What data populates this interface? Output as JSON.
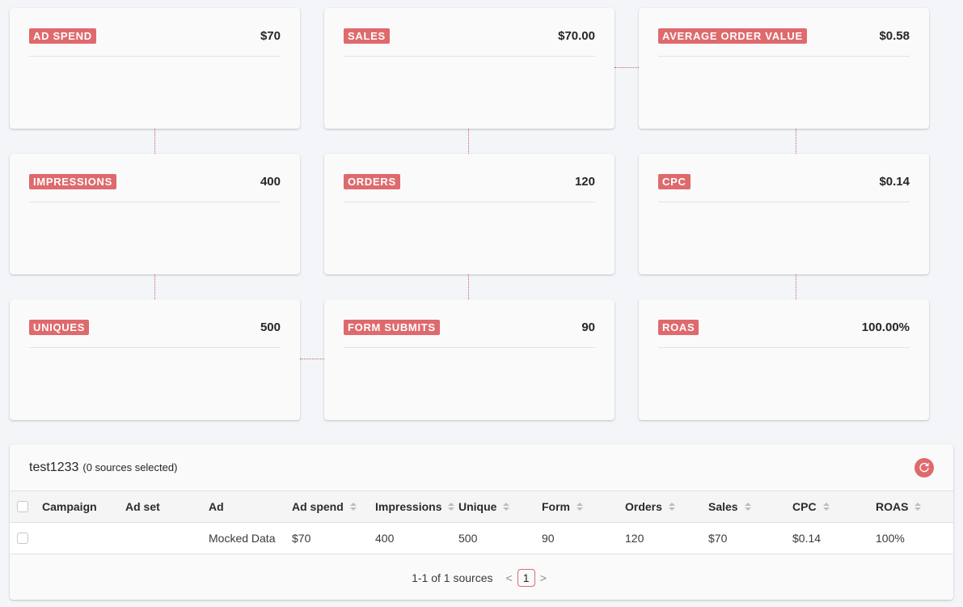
{
  "metrics": {
    "ad_spend": {
      "label": "AD SPEND",
      "value": "$70"
    },
    "sales": {
      "label": "SALES",
      "value": "$70.00"
    },
    "aov": {
      "label": "AVERAGE ORDER VALUE",
      "value": "$0.58"
    },
    "impressions": {
      "label": "IMPRESSIONS",
      "value": "400"
    },
    "orders": {
      "label": "ORDERS",
      "value": "120"
    },
    "cpc": {
      "label": "CPC",
      "value": "$0.14"
    },
    "uniques": {
      "label": "UNIQUES",
      "value": "500"
    },
    "form_submits": {
      "label": "FORM SUBMITS",
      "value": "90"
    },
    "roas": {
      "label": "ROAS",
      "value": "100.00%"
    }
  },
  "panel": {
    "title": "test1233",
    "subtitle": "(0 sources selected)",
    "refresh_icon": "refresh-icon"
  },
  "table": {
    "headers": {
      "campaign": "Campaign",
      "ad_set": "Ad set",
      "ad": "Ad",
      "ad_spend": "Ad spend",
      "impressions": "Impressions",
      "unique": "Unique",
      "form": "Form",
      "orders": "Orders",
      "sales": "Sales",
      "cpc": "CPC",
      "roas": "ROAS"
    },
    "rows": [
      {
        "campaign": "",
        "ad_set": "",
        "ad": "Mocked Data",
        "ad_spend": "$70",
        "impressions": "400",
        "unique": "500",
        "form": "90",
        "orders": "120",
        "sales": "$70",
        "cpc": "$0.14",
        "roas": "100%"
      }
    ]
  },
  "pagination": {
    "summary": "1-1 of 1 sources",
    "prev": "<",
    "current_page": "1",
    "next": ">"
  },
  "colors": {
    "accent": "#de6a6d",
    "background": "#f3f5f8",
    "card": "#fafafa"
  }
}
